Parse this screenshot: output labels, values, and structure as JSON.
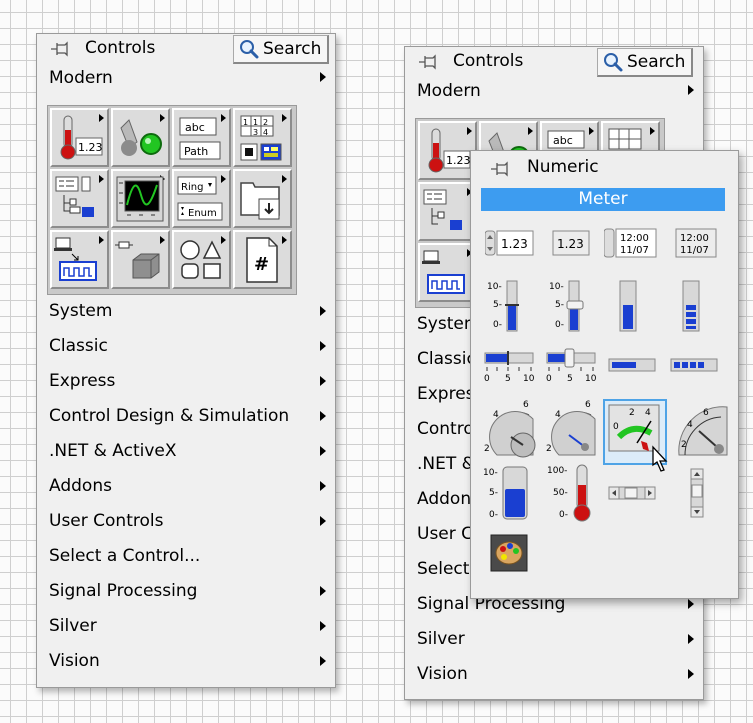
{
  "left_palette": {
    "title": "Controls",
    "search_label": "Search",
    "category": "Modern",
    "items": [
      "System",
      "Classic",
      "Express",
      "Control Design & Simulation",
      ".NET & ActiveX",
      "Addons",
      "User Controls",
      "Select a Control...",
      "Signal Processing",
      "Silver",
      "Vision"
    ]
  },
  "right_palette": {
    "title": "Controls",
    "search_label": "Search",
    "category": "Modern",
    "items": [
      "System",
      "Classic",
      "Express",
      "Control Design & Simulation",
      ".NET & ActiveX",
      "Addons",
      "User Controls",
      "Select a Control...",
      "Signal Processing",
      "Silver",
      "Vision"
    ]
  },
  "icon_grid": {
    "labels": {
      "numeric": "1.23",
      "string_abc": "abc",
      "path": "Path",
      "ring": "Ring",
      "enum": "Enum",
      "array_cells": [
        "1",
        "1",
        "2",
        "3",
        "4"
      ],
      "hash": "#"
    }
  },
  "numeric_popup": {
    "title": "Numeric",
    "highlighted": "Meter",
    "labels": {
      "num_control": "1.23",
      "num_indicator": "1.23",
      "time_line1": "12:00",
      "time_line2": "11/07",
      "vslide_ticks": [
        "10-",
        "5-",
        "0-"
      ],
      "hslide_ticks": [
        "0",
        "5",
        "10"
      ],
      "knob_ticks": [
        "2",
        "4",
        "6"
      ],
      "meter_ticks": [
        "0",
        "2",
        "4"
      ],
      "tank_ticks": [
        "10-",
        "5-",
        "0-"
      ],
      "thermo_ticks": [
        "100-",
        "50-",
        "0-"
      ]
    }
  },
  "colors": {
    "highlight": "#3d9cf0",
    "accent_blue": "#1a3fd1",
    "thermo_red": "#cc1111",
    "led_green": "#22c522"
  }
}
